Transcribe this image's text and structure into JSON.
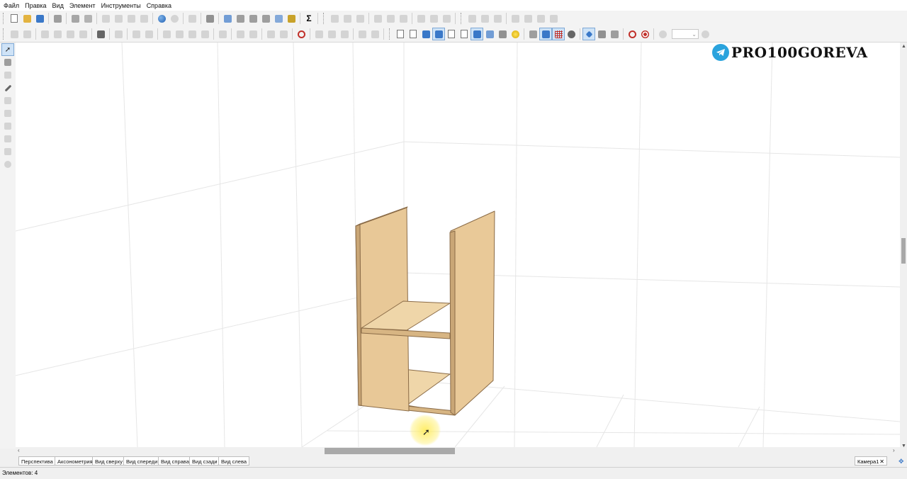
{
  "menu": [
    "Файл",
    "Правка",
    "Вид",
    "Элемент",
    "Инструменты",
    "Справка"
  ],
  "toolbar1": {
    "sum_label": "Σ"
  },
  "logo": {
    "text": "PRO100GOREVA",
    "icon": "telegram-icon",
    "color": "#2aa3dd"
  },
  "view_tabs": [
    "Перспектива",
    "Аксонометрия",
    "Вид сверху",
    "Вид спереди",
    "Вид справа",
    "Вид сзади",
    "Вид слева"
  ],
  "camera_tab": {
    "label": "Камера1",
    "close": "✕"
  },
  "status": {
    "elements": "Элементов: 4"
  },
  "scene": {
    "object": "cabinet-carcass",
    "panel_color": "#e8c897",
    "edge_color": "#8a6b47"
  }
}
